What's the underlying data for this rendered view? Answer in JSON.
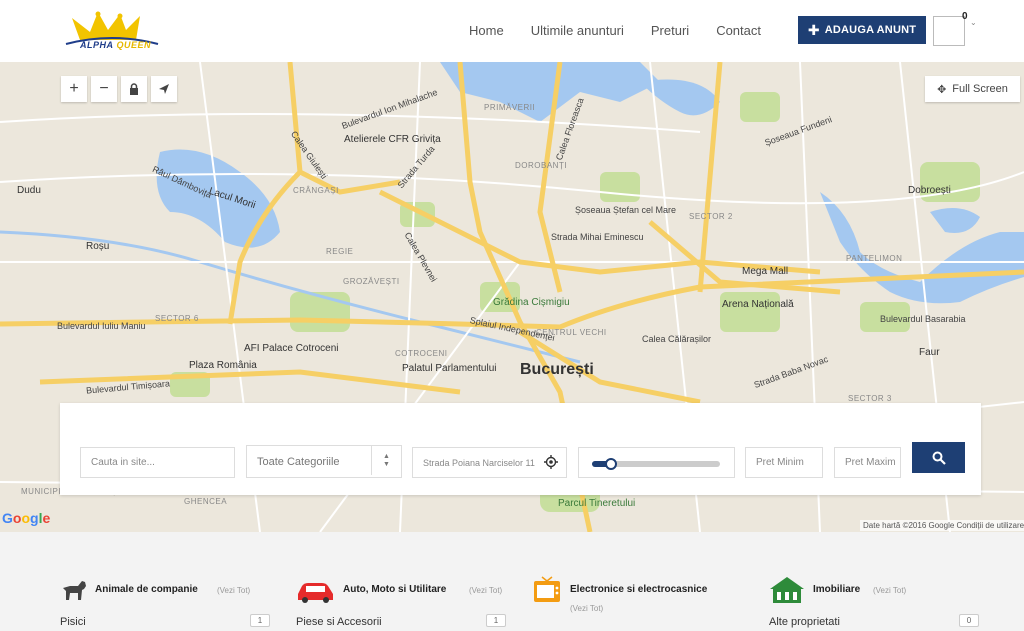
{
  "header": {
    "logo": {
      "text_a": "ALPHA",
      "text_b": "QUEEN"
    },
    "nav": [
      {
        "label": "Home"
      },
      {
        "label": "Ultimile anunturi"
      },
      {
        "label": "Preturi"
      },
      {
        "label": "Contact"
      }
    ],
    "add_button": "ADAUGA ANUNT",
    "user_count": "0"
  },
  "map": {
    "fullscreen_label": "Full Screen",
    "attribution": "Date hartă ©2016 Google    Condiții de utilizare",
    "labels": {
      "bucuresti": "București",
      "lacul_morii": "Lacul Morii",
      "dudu": "Dudu",
      "rosu": "Roșu",
      "dobroesti": "Dobroești",
      "pantelimon": "PANTELIMON",
      "crangasi": "CRÂNGAȘI",
      "regie": "REGIE",
      "grozavesti": "GROZĂVEȘTI",
      "cotroceni": "COTROCENI",
      "dorobanti": "DOROBANȚI",
      "primaverii": "PRIMĂVERII",
      "sector2": "SECTOR 2",
      "sector6": "SECTOR 6",
      "sector3": "SECTOR 3",
      "centrul_vechi": "CENTRUL VECHI",
      "ghencea": "GHENCEA",
      "municipiul": "MUNICIPIUL BUCUREȘTI",
      "mega_mall": "Mega Mall",
      "arena": "Arena Națională",
      "afi": "AFI Palace Cotroceni",
      "plaza": "Plaza România",
      "palatul": "Palatul Parlamentului",
      "gradina": "Grădina Cișmigiu",
      "ateliere": "Atelierele CFR Grivița",
      "faur": "Faur",
      "tineretului": "Parcul Tineretului",
      "iuliu": "Bulevardul Iuliu Maniu",
      "splaiul": "Splaiul Independenței",
      "timisoara": "Bulevardul Timișoara",
      "basarabia": "Bulevardul Basarabia",
      "fundeni": "Șoseaua Fundeni",
      "stefan": "Șoseaua Ștefan cel Mare",
      "mihalache": "Bulevardul Ion Mihalache",
      "eminescu": "Strada Mihai Eminescu",
      "calarasilor": "Calea Călărașilor",
      "giulesti": "Calea Giulești",
      "turda": "Strada Turda",
      "plevnei": "Calea Plevnei",
      "dambovita": "Râul Dâmbovița",
      "floreasca": "Calea Floreasca",
      "baba_novac": "Strada Baba Novac"
    }
  },
  "search": {
    "keyword_placeholder": "Cauta in site...",
    "category_value": "Toate Categoriile",
    "location_value": "Strada Poiana Narciselor 11",
    "slider_position": 0.15,
    "price_min_placeholder": "Pret Minim",
    "price_max_placeholder": "Pret Maxim"
  },
  "categories": [
    {
      "title": "Animale de companie",
      "see_all": "(Vezi Tot)",
      "sub": "Pisici",
      "count": "1"
    },
    {
      "title": "Auto, Moto si Utilitare",
      "see_all": "(Vezi Tot)",
      "sub": "Piese si Accesorii",
      "count": "1"
    },
    {
      "title": "Electronice si electrocasnice",
      "see_all": "(Vezi Tot)",
      "sub": "",
      "count": ""
    },
    {
      "title": "Imobiliare",
      "see_all": "(Vezi Tot)",
      "sub": "Alte proprietati",
      "count": "0"
    }
  ],
  "colors": {
    "primary": "#1e3f74",
    "water": "#a4c8f0",
    "road_major": "#f6cf65",
    "park": "#c8df9f"
  }
}
